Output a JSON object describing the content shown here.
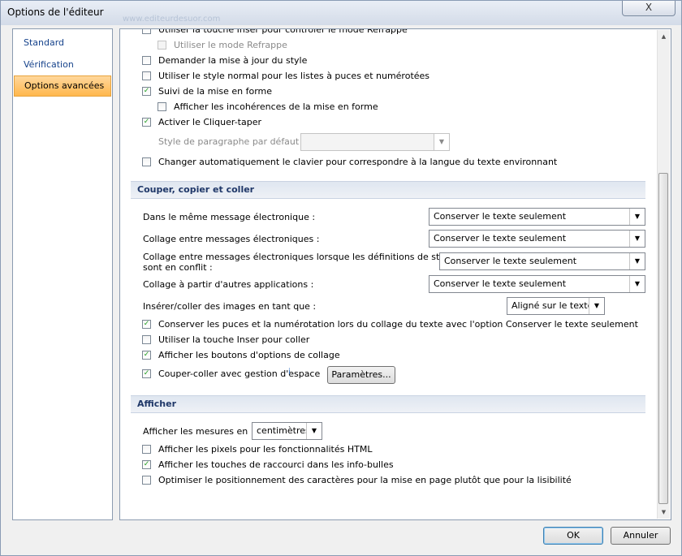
{
  "window": {
    "title": "Options de l'éditeur",
    "title_ghost": "www.editeurdesuor.com",
    "close_label": "X"
  },
  "sidebar": {
    "items": [
      {
        "label": "Standard"
      },
      {
        "label": "Vérification"
      },
      {
        "label": "Options avancées"
      }
    ]
  },
  "top_options": [
    {
      "label": "Utiliser la touche Inser pour contrôler le mode Refrappe",
      "checked": false,
      "disabled": false,
      "cut": true
    },
    {
      "label": "Utiliser le mode Refrappe",
      "checked": false,
      "disabled": true
    },
    {
      "label": "Demander la mise à jour du style",
      "checked": false
    },
    {
      "label": "Utiliser le style normal pour les listes à puces et numérotées",
      "checked": false
    },
    {
      "label": "Suivi de la mise en forme",
      "checked": true
    },
    {
      "label": "Afficher les incohérences de la mise en forme",
      "checked": false
    },
    {
      "label": "Activer le Cliquer-taper",
      "checked": true
    },
    {
      "label": "Changer automatiquement le clavier pour correspondre à la langue du texte environnant",
      "checked": false
    }
  ],
  "paragraph_style": {
    "label": "Style de paragraphe par défaut :",
    "value": ""
  },
  "cut_copy_paste": {
    "header": "Couper, copier et coller",
    "dropdowns": [
      {
        "label": "Dans le même message électronique :",
        "value": "Conserver le texte seulement"
      },
      {
        "label": "Collage entre messages électroniques :",
        "value": "Conserver le texte seulement"
      },
      {
        "label": "Collage entre messages électroniques lorsque les définitions de style",
        "label2": "sont en conflit :",
        "value": "Conserver le texte seulement"
      },
      {
        "label": "Collage à partir d'autres applications :",
        "value": "Conserver le texte seulement"
      }
    ],
    "images": {
      "label": "Insérer/coller des images en tant que :",
      "value": "Aligné sur le texte"
    },
    "options": [
      {
        "label": "Conserver les puces et la numérotation lors du collage du texte avec l'option Conserver le texte seulement",
        "checked": true
      },
      {
        "label": "Utiliser la touche Inser pour coller",
        "checked": false
      },
      {
        "label": "Afficher les boutons d'options de collage",
        "checked": true
      },
      {
        "label": "Couper-coller avec gestion d'espace",
        "checked": true
      }
    ],
    "info_icon": "i",
    "settings_button": "Paramètres..."
  },
  "display": {
    "header": "Afficher",
    "units": {
      "label": "Afficher les mesures en :",
      "value": "centimètres"
    },
    "options": [
      {
        "label": "Afficher les pixels pour les fonctionnalités HTML",
        "checked": false
      },
      {
        "label": "Afficher les touches de raccourci dans les info-bulles",
        "checked": true
      },
      {
        "label": "Optimiser le positionnement des caractères pour la mise en page plutôt que pour la lisibilité",
        "checked": false
      }
    ]
  },
  "checkmark": "✓",
  "footer": {
    "ok": "OK",
    "cancel": "Annuler"
  }
}
